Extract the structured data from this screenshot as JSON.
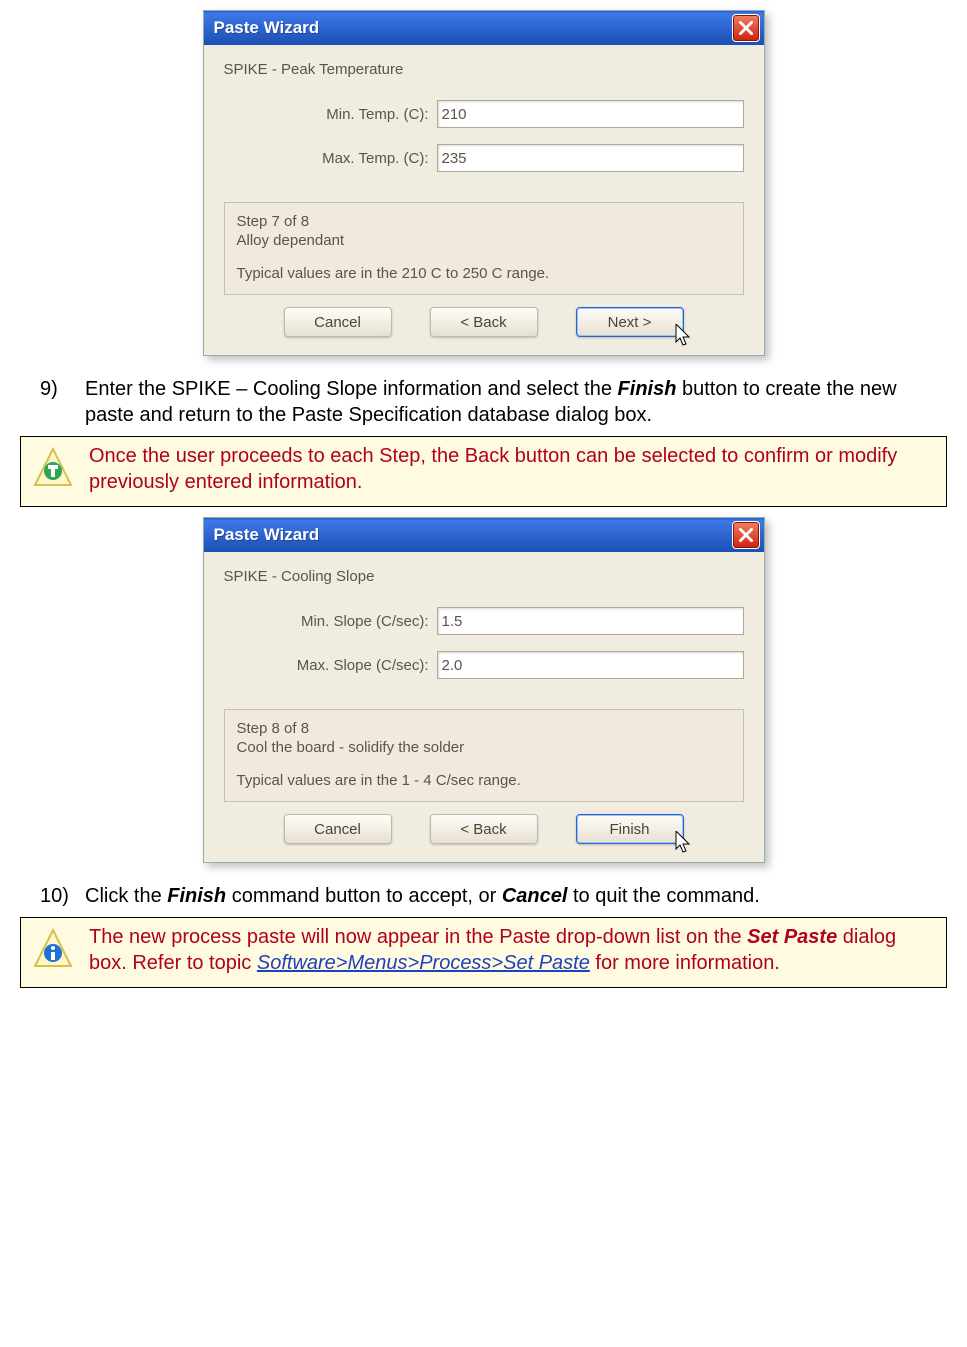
{
  "wizard1": {
    "title": "Paste Wizard",
    "heading": "SPIKE - Peak Temperature",
    "min_label": "Min. Temp. (C):",
    "min_value": "210",
    "max_label": "Max. Temp. (C):",
    "max_value": "235",
    "step": "Step 7 of 8",
    "subhead": "Alloy dependant",
    "typical": "Typical values are in the 210 C to 250 C range.",
    "cancel": "Cancel",
    "back": "< Back",
    "next": "Next >"
  },
  "step9": {
    "num": "9)",
    "text_before": "Enter the SPIKE – Cooling Slope information and select the ",
    "finish_word": "Finish",
    "text_after": " button to create the new paste and return to the Paste Specification database dialog box."
  },
  "note1": {
    "text": "Once the user proceeds to each Step, the Back button can be selected to confirm or modify previously entered information."
  },
  "wizard2": {
    "title": "Paste Wizard",
    "heading": "SPIKE - Cooling Slope",
    "min_label": "Min. Slope (C/sec):",
    "min_value": "1.5",
    "max_label": "Max. Slope (C/sec):",
    "max_value": "2.0",
    "step": "Step 8 of 8",
    "subhead": "Cool the board - solidify the solder",
    "typical": "Typical values are in the 1 - 4 C/sec range.",
    "cancel": "Cancel",
    "back": "< Back",
    "finish": "Finish"
  },
  "step10": {
    "num": "10)",
    "text_before": "Click the ",
    "finish_word": "Finish",
    "text_mid": " command button to accept, or ",
    "cancel_word": "Cancel",
    "text_after": " to quit the command."
  },
  "note2": {
    "text_before": "The new process paste will now appear in the Paste drop-down list on the ",
    "set_paste_word": "Set Paste",
    "text_mid": " dialog box. Refer to topic ",
    "link_text": "Software>Menus>Process>Set Paste",
    "text_after": " for more information."
  }
}
